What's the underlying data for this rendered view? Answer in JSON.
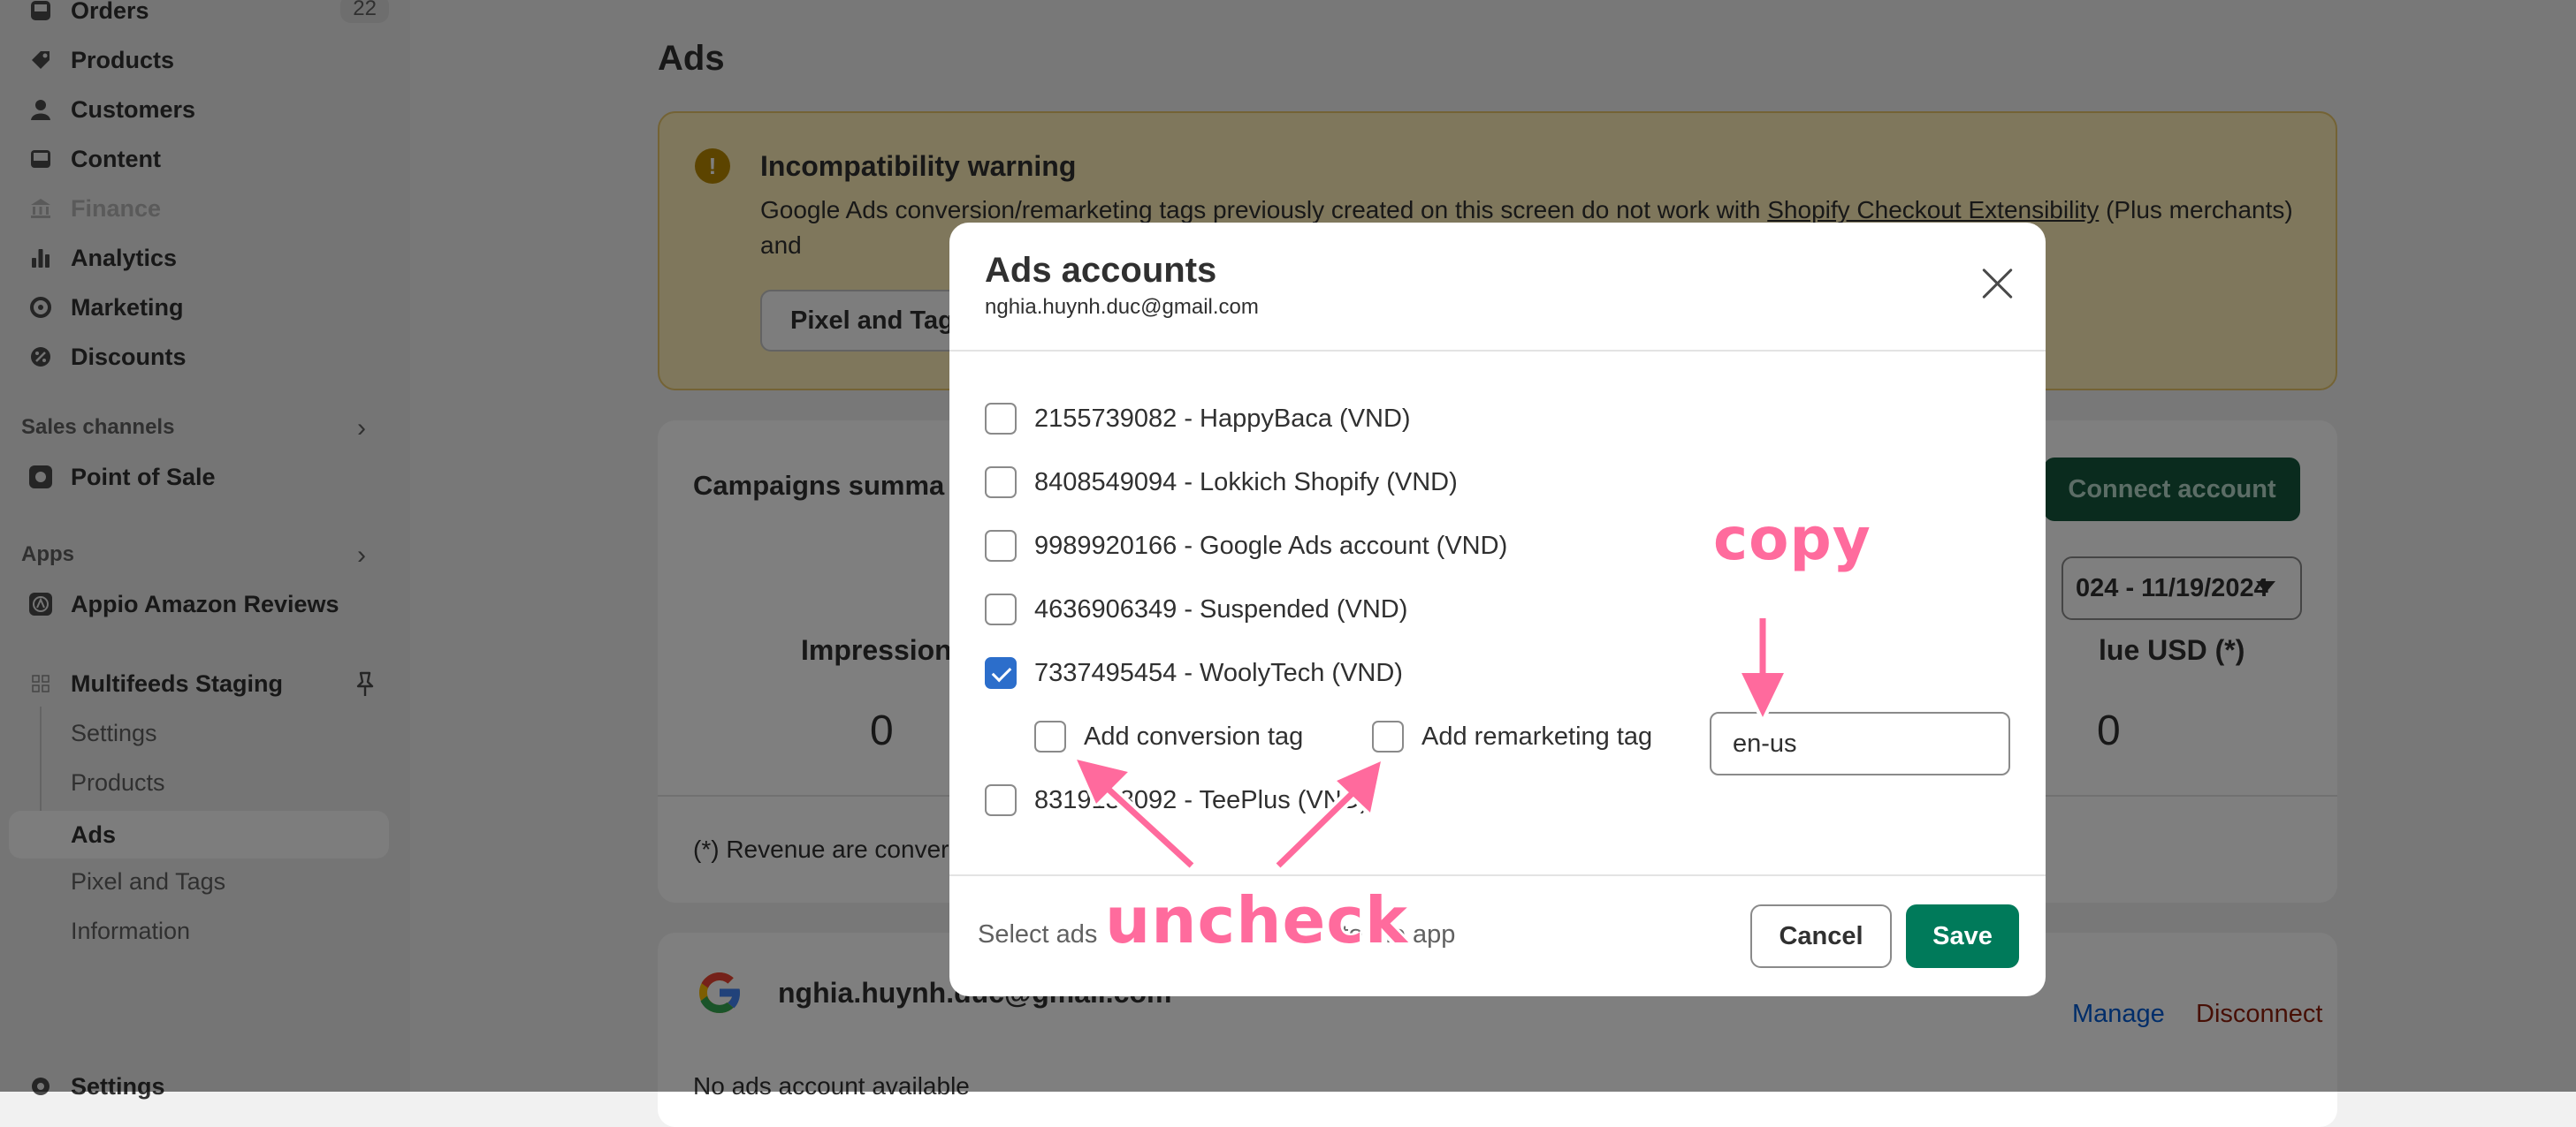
{
  "sidebar": {
    "items": [
      {
        "label": "Orders",
        "badge": "22"
      },
      {
        "label": "Products"
      },
      {
        "label": "Customers"
      },
      {
        "label": "Content"
      },
      {
        "label": "Finance"
      },
      {
        "label": "Analytics"
      },
      {
        "label": "Marketing"
      },
      {
        "label": "Discounts"
      }
    ],
    "sales_channels_title": "Sales channels",
    "pos_label": "Point of Sale",
    "apps_title": "Apps",
    "appio_label": "Appio Amazon Reviews",
    "app_name": "Multifeeds Staging",
    "app_sub_items": [
      "Settings",
      "Products",
      "Ads",
      "Pixel and Tags",
      "Information"
    ],
    "settings_label": "Settings"
  },
  "page": {
    "title": "Ads",
    "warning": {
      "title": "Incompatibility warning",
      "text_before_link": "Google Ads conversion/remarketing tags previously created on this screen do not work with ",
      "link": "Shopify Checkout Extensibility",
      "text_after_link": " (Plus merchants) and ",
      "button": "Pixel and Tags"
    },
    "campaigns": {
      "title": "Campaigns summa",
      "connect_button": "Connect account",
      "date_range": "024 - 11/19/2024",
      "metrics": [
        {
          "label": "Impressions",
          "value": "0"
        },
        {
          "label": "lue USD (*)",
          "value": "0"
        }
      ],
      "note": "(*) Revenue are conver"
    },
    "google": {
      "email": "nghia.huynh.duc@gmail.com",
      "manage": "Manage",
      "disconnect": "Disconnect",
      "no_account": "No ads account available"
    }
  },
  "modal": {
    "title": "Ads accounts",
    "subtitle": "nghia.huynh.duc@gmail.com",
    "accounts": [
      {
        "label": "2155739082 - HappyBaca (VND)",
        "checked": false
      },
      {
        "label": "8408549094 - Lokkich Shopify (VND)",
        "checked": false
      },
      {
        "label": "9989920166 - Google Ads account (VND)",
        "checked": false
      },
      {
        "label": "4636906349 - Suspended (VND)",
        "checked": false
      },
      {
        "label": "7337495454 - WoolyTech (VND)",
        "checked": true
      },
      {
        "label": "8319138092 - TeePlus (VND)",
        "checked": false
      }
    ],
    "conversion_tag_label": "Add conversion tag",
    "remarketing_tag_label": "Add remarketing tag",
    "language_value": "en-us",
    "footer_text": "Select ads",
    "footer_text_end": "to the app",
    "cancel": "Cancel",
    "save": "Save"
  },
  "annotations": {
    "copy": "copy",
    "uncheck": "uncheck",
    "color": "#ff6b9d"
  }
}
